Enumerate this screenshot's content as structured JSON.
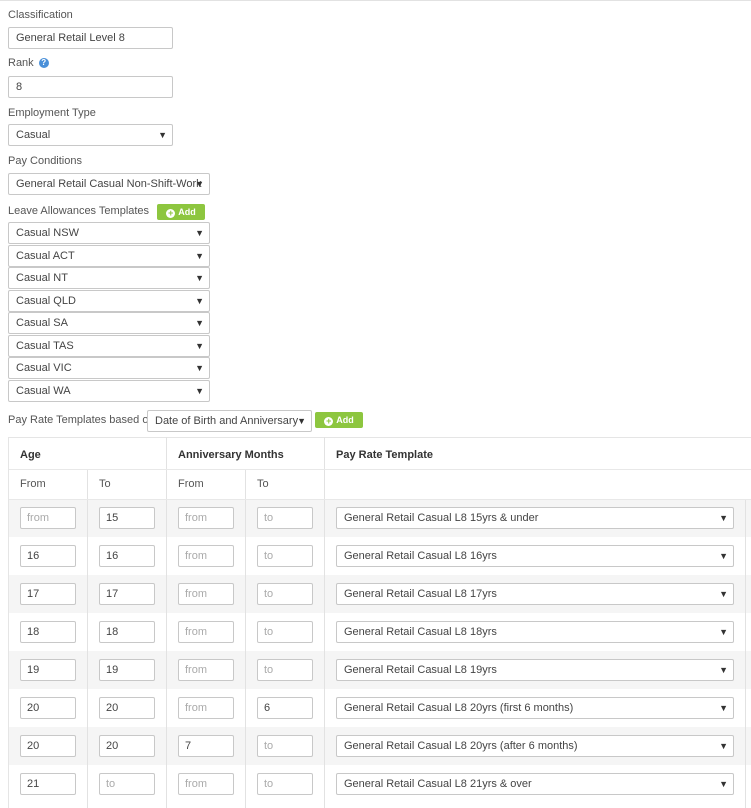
{
  "classification": {
    "label": "Classification",
    "value": "General Retail Level 8"
  },
  "rank": {
    "label": "Rank",
    "value": "8",
    "help_icon": "question-circle-icon"
  },
  "employment_type": {
    "label": "Employment Type",
    "value": "Casual"
  },
  "pay_conditions": {
    "label": "Pay Conditions",
    "value": "General Retail Casual Non-Shift-Work"
  },
  "leave_allowances": {
    "label": "Leave Allowances Templates",
    "add_label": "Add",
    "items": [
      "Casual NSW",
      "Casual ACT",
      "Casual NT",
      "Casual QLD",
      "Casual SA",
      "Casual TAS",
      "Casual VIC",
      "Casual WA"
    ]
  },
  "pay_rate": {
    "label": "Pay Rate Templates based on",
    "basis": "Date of Birth and Anniversary",
    "add_label": "Add"
  },
  "table": {
    "headers": {
      "age": "Age",
      "anniversary": "Anniversary Months",
      "template": "Pay Rate Template"
    },
    "sub_headers": {
      "age_from": "From",
      "age_to": "To",
      "ann_from": "From",
      "ann_to": "To"
    },
    "placeholders": {
      "from": "from",
      "to": "to"
    },
    "rows": [
      {
        "age_from": "",
        "age_to": "15",
        "ann_from": "",
        "ann_to": "",
        "template": "General Retail Casual L8 15yrs & under"
      },
      {
        "age_from": "16",
        "age_to": "16",
        "ann_from": "",
        "ann_to": "",
        "template": "General Retail Casual L8 16yrs"
      },
      {
        "age_from": "17",
        "age_to": "17",
        "ann_from": "",
        "ann_to": "",
        "template": "General Retail Casual L8 17yrs"
      },
      {
        "age_from": "18",
        "age_to": "18",
        "ann_from": "",
        "ann_to": "",
        "template": "General Retail Casual L8 18yrs"
      },
      {
        "age_from": "19",
        "age_to": "19",
        "ann_from": "",
        "ann_to": "",
        "template": "General Retail Casual L8 19yrs"
      },
      {
        "age_from": "20",
        "age_to": "20",
        "ann_from": "",
        "ann_to": "6",
        "template": "General Retail Casual L8 20yrs (first 6 months)"
      },
      {
        "age_from": "20",
        "age_to": "20",
        "ann_from": "7",
        "ann_to": "",
        "template": "General Retail Casual L8 20yrs (after 6 months)"
      },
      {
        "age_from": "21",
        "age_to": "",
        "ann_from": "",
        "ann_to": "",
        "template": "General Retail Casual L8 21yrs & over"
      }
    ]
  },
  "colors": {
    "add_button": "#8dc63f",
    "help_icon": "#4a90d9",
    "row_stripe": "#f5f5f5"
  }
}
